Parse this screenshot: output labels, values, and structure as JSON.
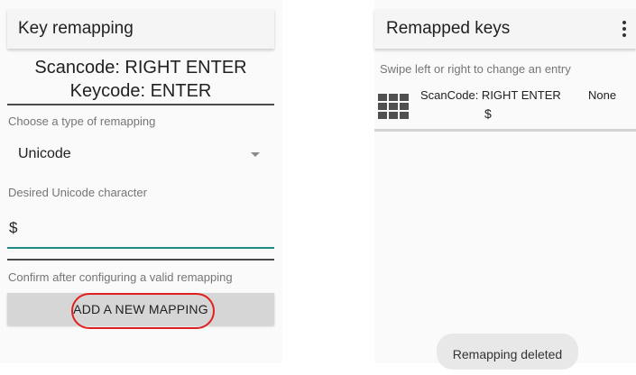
{
  "left": {
    "title": "Key remapping",
    "scancode_line": "Scancode: RIGHT ENTER",
    "keycode_line": "Keycode: ENTER",
    "type_label": "Choose a type of remapping",
    "type_value": "Unicode",
    "char_label": "Desired Unicode character",
    "char_value": "$",
    "confirm_text": "Confirm after configuring a valid remapping",
    "add_button": "ADD A NEW MAPPING",
    "highlight_color": "#e02020",
    "accent_color": "#1f8a85"
  },
  "right": {
    "title": "Remapped keys",
    "overflow_icon": "more-vertical-icon",
    "hint": "Swipe left or right to change an entry",
    "entry": {
      "icon": "keyboard-grid-icon",
      "scancode": "ScanCode: RIGHT ENTER",
      "mapped": "None",
      "character": "$"
    },
    "toast": "Remapping deleted"
  }
}
